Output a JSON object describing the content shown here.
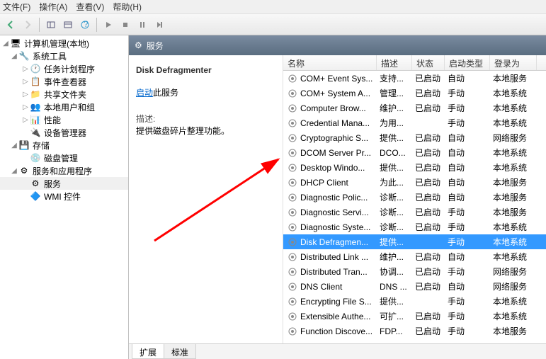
{
  "menu": {
    "file": "文件(F)",
    "action": "操作(A)",
    "view": "查看(V)",
    "help": "帮助(H)"
  },
  "tree": {
    "root": "计算机管理(本地)",
    "systools": "系统工具",
    "sched": "任务计划程序",
    "eventv": "事件查看器",
    "shared": "共享文件夹",
    "users": "本地用户和组",
    "perf": "性能",
    "devmgr": "设备管理器",
    "storage": "存储",
    "diskmgmt": "磁盘管理",
    "svcapp": "服务和应用程序",
    "services": "服务",
    "wmi": "WMI 控件"
  },
  "header": {
    "title": "服务"
  },
  "detail": {
    "title": "Disk Defragmenter",
    "startLink": "启动",
    "startSuffix": "此服务",
    "descLabel": "描述:",
    "descText": "提供磁盘碎片整理功能。"
  },
  "cols": {
    "name": "名称",
    "desc": "描述",
    "status": "状态",
    "start": "启动类型",
    "logon": "登录为"
  },
  "tabs": {
    "ext": "扩展",
    "std": "标准"
  },
  "rows": [
    {
      "name": "COM+ Event Sys...",
      "desc": "支持...",
      "status": "已启动",
      "start": "自动",
      "logon": "本地服务"
    },
    {
      "name": "COM+ System A...",
      "desc": "管理...",
      "status": "已启动",
      "start": "手动",
      "logon": "本地系统"
    },
    {
      "name": "Computer Brow...",
      "desc": "维护...",
      "status": "已启动",
      "start": "手动",
      "logon": "本地系统"
    },
    {
      "name": "Credential Mana...",
      "desc": "为用...",
      "status": "",
      "start": "手动",
      "logon": "本地系统"
    },
    {
      "name": "Cryptographic S...",
      "desc": "提供...",
      "status": "已启动",
      "start": "自动",
      "logon": "网络服务"
    },
    {
      "name": "DCOM Server Pr...",
      "desc": "DCO...",
      "status": "已启动",
      "start": "自动",
      "logon": "本地系统"
    },
    {
      "name": "Desktop Windo...",
      "desc": "提供...",
      "status": "已启动",
      "start": "自动",
      "logon": "本地系统"
    },
    {
      "name": "DHCP Client",
      "desc": "为此...",
      "status": "已启动",
      "start": "自动",
      "logon": "本地服务"
    },
    {
      "name": "Diagnostic Polic...",
      "desc": "诊断...",
      "status": "已启动",
      "start": "自动",
      "logon": "本地服务"
    },
    {
      "name": "Diagnostic Servi...",
      "desc": "诊断...",
      "status": "已启动",
      "start": "手动",
      "logon": "本地服务"
    },
    {
      "name": "Diagnostic Syste...",
      "desc": "诊断...",
      "status": "已启动",
      "start": "手动",
      "logon": "本地系统"
    },
    {
      "name": "Disk Defragmen...",
      "desc": "提供...",
      "status": "",
      "start": "手动",
      "logon": "本地系统",
      "selected": true
    },
    {
      "name": "Distributed Link ...",
      "desc": "维护...",
      "status": "已启动",
      "start": "自动",
      "logon": "本地系统"
    },
    {
      "name": "Distributed Tran...",
      "desc": "协调...",
      "status": "已启动",
      "start": "手动",
      "logon": "网络服务"
    },
    {
      "name": "DNS Client",
      "desc": "DNS ...",
      "status": "已启动",
      "start": "自动",
      "logon": "网络服务"
    },
    {
      "name": "Encrypting File S...",
      "desc": "提供...",
      "status": "",
      "start": "手动",
      "logon": "本地系统"
    },
    {
      "name": "Extensible Authe...",
      "desc": "可扩...",
      "status": "已启动",
      "start": "手动",
      "logon": "本地系统"
    },
    {
      "name": "Function Discove...",
      "desc": "FDP...",
      "status": "已启动",
      "start": "手动",
      "logon": "本地服务"
    }
  ]
}
